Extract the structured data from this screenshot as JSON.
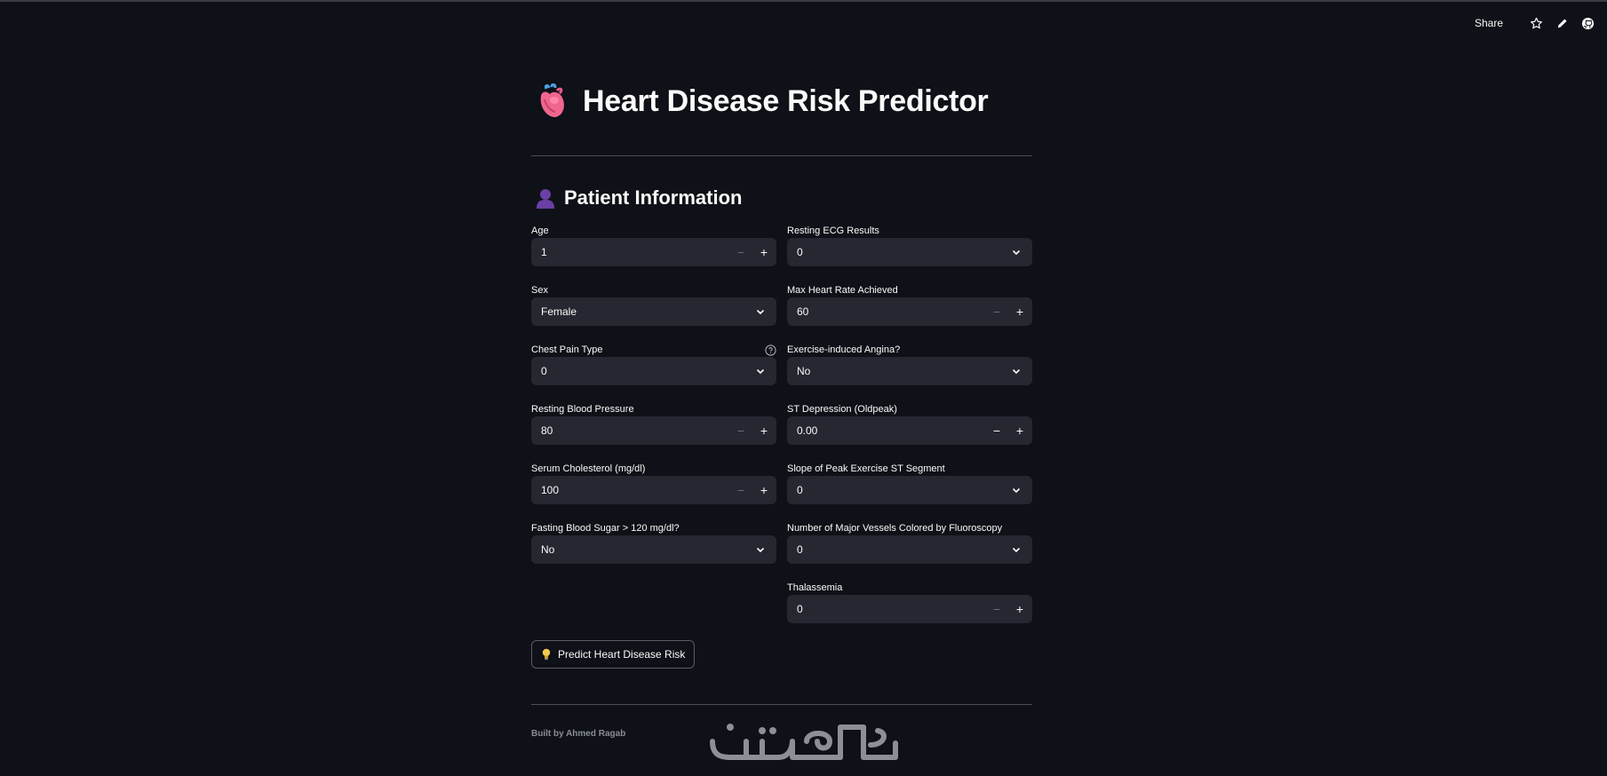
{
  "toolbar": {
    "share_label": "Share",
    "icons": [
      "star-icon",
      "pencil-icon",
      "github-icon"
    ]
  },
  "header": {
    "title": "Heart Disease Risk Predictor",
    "icon": "anatomical-heart-icon"
  },
  "section": {
    "title": "Patient Information",
    "icon": "person-silhouette-icon"
  },
  "fields": {
    "age": {
      "label": "Age",
      "value": "1",
      "type": "number"
    },
    "sex": {
      "label": "Sex",
      "value": "Female",
      "type": "select"
    },
    "chest_pain": {
      "label": "Chest Pain Type",
      "value": "0",
      "type": "select"
    },
    "resting_bp": {
      "label": "Resting Blood Pressure",
      "value": "80",
      "type": "number"
    },
    "cholesterol": {
      "label": "Serum Cholesterol (mg/dl)",
      "value": "100",
      "type": "number"
    },
    "fasting_sugar": {
      "label": "Fasting Blood Sugar > 120 mg/dl?",
      "value": "No",
      "type": "select"
    },
    "resting_ecg": {
      "label": "Resting ECG Results",
      "value": "0",
      "type": "select"
    },
    "max_hr": {
      "label": "Max Heart Rate Achieved",
      "value": "60",
      "type": "number"
    },
    "angina": {
      "label": "Exercise-induced Angina?",
      "value": "No",
      "type": "select"
    },
    "oldpeak": {
      "label": "ST Depression (Oldpeak)",
      "value": "0.00",
      "type": "number"
    },
    "slope": {
      "label": "Slope of Peak Exercise ST Segment",
      "value": "0",
      "type": "select"
    },
    "vessels": {
      "label": "Number of Major Vessels Colored by Fluoroscopy",
      "value": "0",
      "type": "select"
    },
    "thalassemia": {
      "label": "Thalassemia",
      "value": "0",
      "type": "number"
    }
  },
  "stepper": {
    "minus": "−",
    "plus": "+"
  },
  "predict_button": {
    "label": "Predict Heart Disease Risk",
    "icon": "lightbulb-icon"
  },
  "footer": {
    "text": "Built by Ahmed Ragab"
  },
  "watermark": {
    "text": "خمسات"
  },
  "colors": {
    "background": "#0e1117",
    "input_bg": "#262730",
    "text": "#fafafa",
    "muted": "#8a8d95"
  }
}
